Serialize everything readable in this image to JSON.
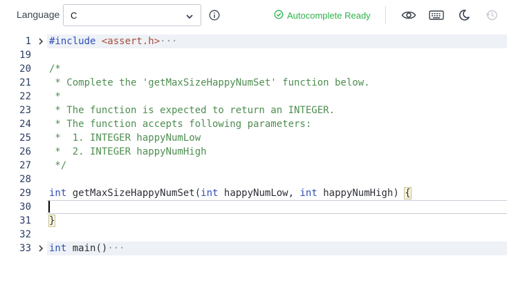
{
  "toolbar": {
    "language_label": "Language",
    "language_value": "C",
    "status_text": "Autocomplete Ready",
    "status_color": "#2eb24a",
    "icons": [
      "info-icon",
      "check-circle-icon",
      "eye-icon",
      "keyboard-icon",
      "moon-icon",
      "history-icon"
    ]
  },
  "editor": {
    "lines": [
      {
        "num": "1",
        "folded": true,
        "segments": [
          {
            "t": "#include ",
            "c": "kw"
          },
          {
            "t": "<assert.h>",
            "c": "str"
          },
          {
            "t": "···",
            "c": "ell"
          }
        ]
      },
      {
        "num": "19",
        "segments": []
      },
      {
        "num": "20",
        "segments": [
          {
            "t": "/*",
            "c": "comment"
          }
        ]
      },
      {
        "num": "21",
        "segments": [
          {
            "t": " * Complete the 'getMaxSizeHappyNumSet' function below.",
            "c": "comment"
          }
        ]
      },
      {
        "num": "22",
        "segments": [
          {
            "t": " *",
            "c": "comment"
          }
        ]
      },
      {
        "num": "23",
        "segments": [
          {
            "t": " * The function is expected to return an INTEGER.",
            "c": "comment"
          }
        ]
      },
      {
        "num": "24",
        "segments": [
          {
            "t": " * The function accepts following parameters:",
            "c": "comment"
          }
        ]
      },
      {
        "num": "25",
        "segments": [
          {
            "t": " *  1. INTEGER happyNumLow",
            "c": "comment"
          }
        ]
      },
      {
        "num": "26",
        "segments": [
          {
            "t": " *  2. INTEGER happyNumHigh",
            "c": "comment"
          }
        ]
      },
      {
        "num": "27",
        "segments": [
          {
            "t": " */",
            "c": "comment"
          }
        ]
      },
      {
        "num": "28",
        "segments": []
      },
      {
        "num": "29",
        "segments": [
          {
            "t": "int",
            "c": "kw"
          },
          {
            "t": " getMaxSizeHappyNumSet(",
            "c": "plain"
          },
          {
            "t": "int",
            "c": "kw"
          },
          {
            "t": " happyNumLow, ",
            "c": "plain"
          },
          {
            "t": "int",
            "c": "kw"
          },
          {
            "t": " happyNumHigh) ",
            "c": "plain"
          },
          {
            "t": "{",
            "c": "brace"
          }
        ]
      },
      {
        "num": "30",
        "segments": []
      },
      {
        "num": "31",
        "segments": [
          {
            "t": "}",
            "c": "brace"
          }
        ]
      },
      {
        "num": "32",
        "segments": []
      },
      {
        "num": "33",
        "folded": true,
        "segments": [
          {
            "t": "int",
            "c": "kw"
          },
          {
            "t": " main()",
            "c": "plain"
          },
          {
            "t": "···",
            "c": "ell"
          }
        ]
      }
    ]
  }
}
